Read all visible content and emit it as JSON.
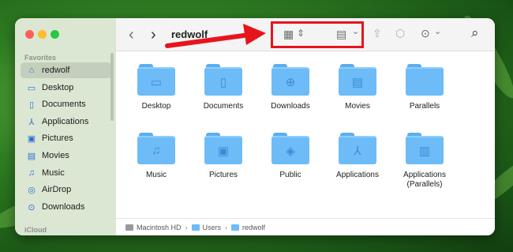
{
  "window": {
    "title": "redwolf"
  },
  "colors": {
    "accent": "#2d6fd6",
    "folder": "#6dbcf7",
    "annotation": "#e8141c"
  },
  "sidebar": {
    "favorites_heading": "Favorites",
    "icloud_heading": "iCloud",
    "items": [
      {
        "label": "redwolf",
        "icon": "home-icon",
        "glyph": "⌂"
      },
      {
        "label": "Desktop",
        "icon": "desktop-icon",
        "glyph": "▭"
      },
      {
        "label": "Documents",
        "icon": "document-icon",
        "glyph": "▯"
      },
      {
        "label": "Applications",
        "icon": "applications-icon",
        "glyph": "⅄"
      },
      {
        "label": "Pictures",
        "icon": "pictures-icon",
        "glyph": "▣"
      },
      {
        "label": "Movies",
        "icon": "movies-icon",
        "glyph": "▤"
      },
      {
        "label": "Music",
        "icon": "music-icon",
        "glyph": "♫"
      },
      {
        "label": "AirDrop",
        "icon": "airdrop-icon",
        "glyph": "◎"
      },
      {
        "label": "Downloads",
        "icon": "downloads-icon",
        "glyph": "⊙"
      }
    ]
  },
  "toolbar": {
    "back_icon": "‹",
    "forward_icon": "›",
    "icon_view": "▦",
    "sort_chevrons": "⇕",
    "group_view": "▤",
    "group_chevron": "⌄",
    "share_icon": "⇪",
    "tag_icon": "⬡",
    "more_icon": "⊙",
    "more_chevron": "⌄",
    "search_icon": "⌕"
  },
  "folders": [
    {
      "label": "Desktop",
      "glyph": "▭"
    },
    {
      "label": "Documents",
      "glyph": "▯"
    },
    {
      "label": "Downloads",
      "glyph": "⊕"
    },
    {
      "label": "Movies",
      "glyph": "▤"
    },
    {
      "label": "Parallels",
      "glyph": ""
    },
    {
      "label": "Music",
      "glyph": "♫"
    },
    {
      "label": "Pictures",
      "glyph": "▣"
    },
    {
      "label": "Public",
      "glyph": "◈"
    },
    {
      "label": "Applications",
      "glyph": "⅄"
    },
    {
      "label": "Applications (Parallels)",
      "glyph": "▥"
    }
  ],
  "pathbar": {
    "segments": [
      "Macintosh HD",
      "Users",
      "redwolf"
    ],
    "separator": "›"
  }
}
